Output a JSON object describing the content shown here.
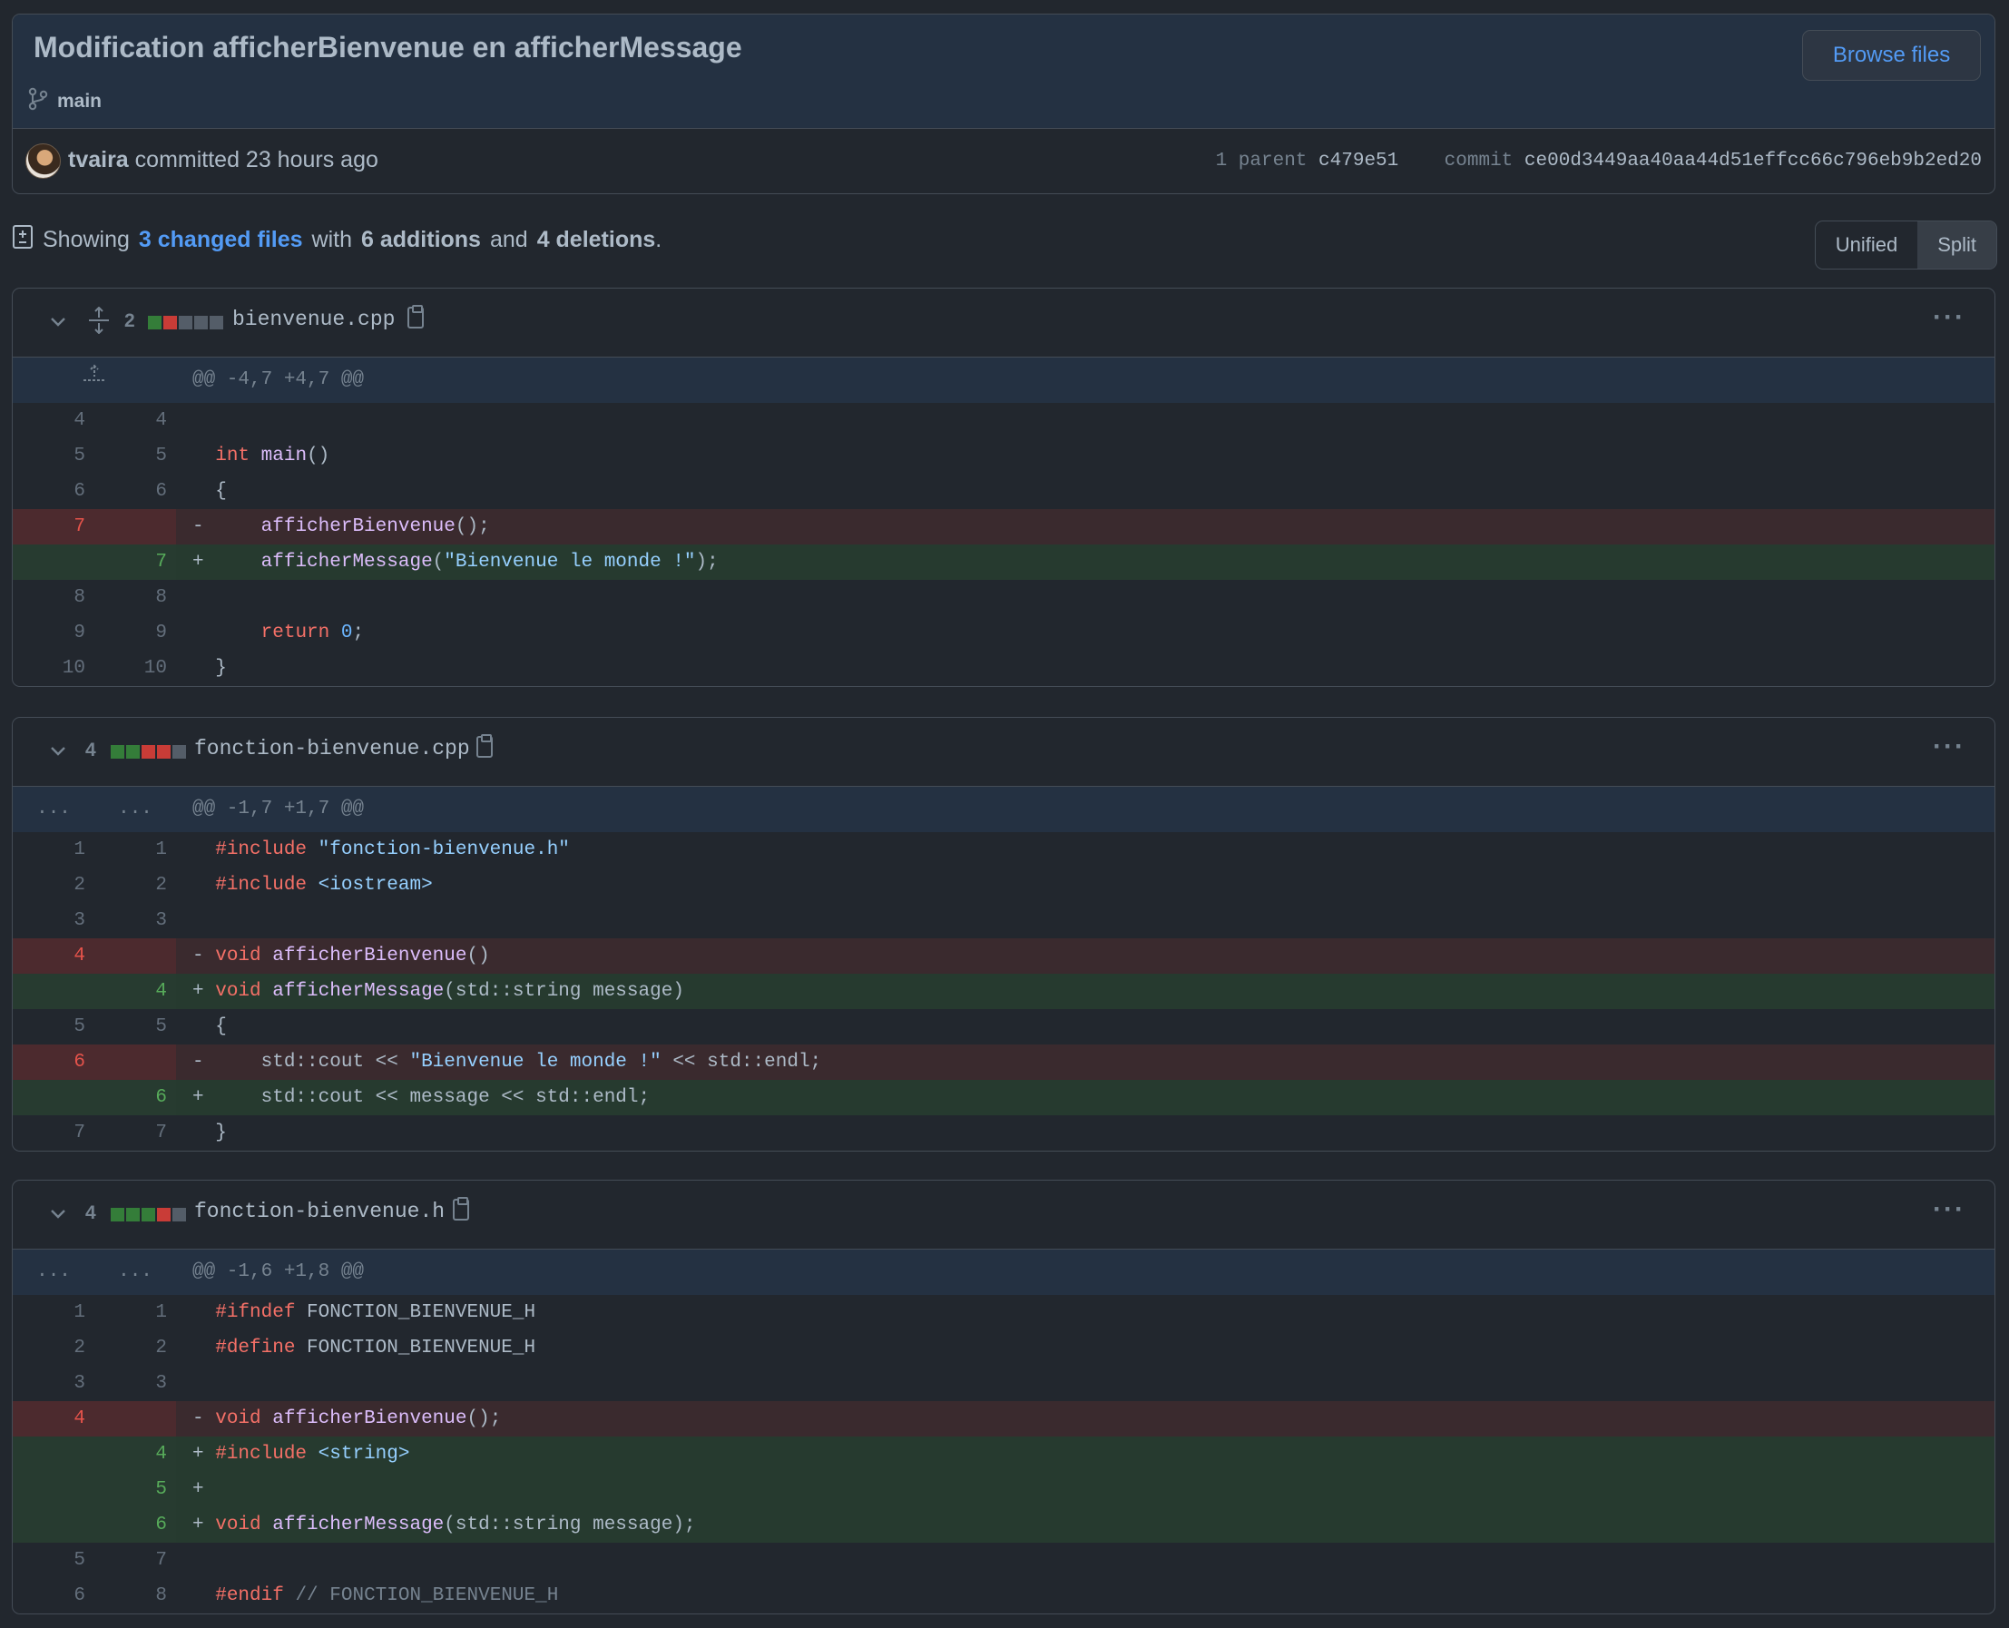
{
  "commit": {
    "title": "Modification afficherBienvenue en afficherMessage",
    "branch": "main",
    "browse_label": "Browse files",
    "author": "tvaira",
    "committed_text": "committed 23 hours ago",
    "parent_label": "1 parent",
    "parent_hash": "c479e51",
    "commit_label": "commit",
    "commit_hash": "ce00d3449aa40aa44d51effcc66c796eb9b2ed20"
  },
  "summary": {
    "prefix": "Showing",
    "changed_files": "3 changed files",
    "with": "with",
    "additions": "6 additions",
    "and": "and",
    "deletions": "4 deletions",
    "suffix": "."
  },
  "view_toggle": {
    "unified": "Unified",
    "split": "Split",
    "selected": "Split"
  },
  "colors": {
    "bg": "#22272e",
    "accent": "#539bf5",
    "added": "#347d39",
    "deleted": "#c93c37"
  },
  "files": [
    {
      "changes": "2",
      "name": "bienvenue.cpp",
      "hunk": "@@ -4,7 +4,7 @@",
      "lines": [
        {
          "old": "4",
          "new": "4",
          "type": "ctx",
          "sign": " ",
          "text": ""
        },
        {
          "old": "5",
          "new": "5",
          "type": "ctx",
          "sign": " ",
          "text": "int main()"
        },
        {
          "old": "6",
          "new": "6",
          "type": "ctx",
          "sign": " ",
          "text": "{"
        },
        {
          "old": "7",
          "new": "",
          "type": "del",
          "sign": "-",
          "text": "    afficherBienvenue();"
        },
        {
          "old": "",
          "new": "7",
          "type": "add",
          "sign": "+",
          "text": "    afficherMessage(\"Bienvenue le monde !\");"
        },
        {
          "old": "8",
          "new": "8",
          "type": "ctx",
          "sign": " ",
          "text": ""
        },
        {
          "old": "9",
          "new": "9",
          "type": "ctx",
          "sign": " ",
          "text": "    return 0;"
        },
        {
          "old": "10",
          "new": "10",
          "type": "ctx",
          "sign": " ",
          "text": "}"
        }
      ]
    },
    {
      "changes": "4",
      "name": "fonction-bienvenue.cpp",
      "hunk": "@@ -1,7 +1,7 @@",
      "lines": [
        {
          "old": "1",
          "new": "1",
          "type": "ctx",
          "sign": " ",
          "text": "#include \"fonction-bienvenue.h\""
        },
        {
          "old": "2",
          "new": "2",
          "type": "ctx",
          "sign": " ",
          "text": "#include <iostream>"
        },
        {
          "old": "3",
          "new": "3",
          "type": "ctx",
          "sign": " ",
          "text": ""
        },
        {
          "old": "4",
          "new": "",
          "type": "del",
          "sign": "-",
          "text": "void afficherBienvenue()"
        },
        {
          "old": "",
          "new": "4",
          "type": "add",
          "sign": "+",
          "text": "void afficherMessage(std::string message)"
        },
        {
          "old": "5",
          "new": "5",
          "type": "ctx",
          "sign": " ",
          "text": "{"
        },
        {
          "old": "6",
          "new": "",
          "type": "del",
          "sign": "-",
          "text": "    std::cout << \"Bienvenue le monde !\" << std::endl;"
        },
        {
          "old": "",
          "new": "6",
          "type": "add",
          "sign": "+",
          "text": "    std::cout << message << std::endl;"
        },
        {
          "old": "7",
          "new": "7",
          "type": "ctx",
          "sign": " ",
          "text": "}"
        }
      ]
    },
    {
      "changes": "4",
      "name": "fonction-bienvenue.h",
      "hunk": "@@ -1,6 +1,8 @@",
      "lines": [
        {
          "old": "1",
          "new": "1",
          "type": "ctx",
          "sign": " ",
          "text": "#ifndef FONCTION_BIENVENUE_H"
        },
        {
          "old": "2",
          "new": "2",
          "type": "ctx",
          "sign": " ",
          "text": "#define FONCTION_BIENVENUE_H"
        },
        {
          "old": "3",
          "new": "3",
          "type": "ctx",
          "sign": " ",
          "text": ""
        },
        {
          "old": "4",
          "new": "",
          "type": "del",
          "sign": "-",
          "text": "void afficherBienvenue();"
        },
        {
          "old": "",
          "new": "4",
          "type": "add",
          "sign": "+",
          "text": "#include <string>"
        },
        {
          "old": "",
          "new": "5",
          "type": "add",
          "sign": "+",
          "text": ""
        },
        {
          "old": "",
          "new": "6",
          "type": "add",
          "sign": "+",
          "text": "void afficherMessage(std::string message);"
        },
        {
          "old": "5",
          "new": "7",
          "type": "ctx",
          "sign": " ",
          "text": ""
        },
        {
          "old": "6",
          "new": "8",
          "type": "ctx",
          "sign": " ",
          "text": "#endif // FONCTION_BIENVENUE_H"
        }
      ]
    }
  ],
  "hunk_expand_label": "..."
}
